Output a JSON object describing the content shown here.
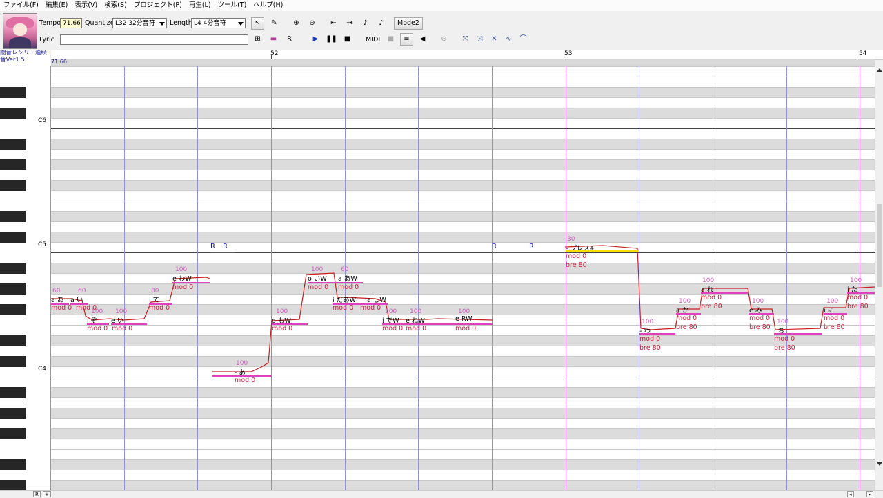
{
  "menu": [
    "ファイル(F)",
    "編集(E)",
    "表示(V)",
    "検索(S)",
    "プロジェクト(P)",
    "再生(L)",
    "ツール(T)",
    "ヘルプ(H)"
  ],
  "toolbar": {
    "tempo_label": "Tempo",
    "tempo_value": "71.66",
    "quantize_label": "Quantize",
    "quantize_value": "L32 32分音符",
    "length_label": "Length",
    "length_value": "L4 4分音符",
    "mode_label": "Mode2",
    "lyric_label": "Lyric",
    "lyric_value": "",
    "midi_label": "MIDI",
    "tool_r_label": "R"
  },
  "track": {
    "name_line1": "闇音レンリ・連続",
    "name_line2": "音Ver1.5",
    "tempo_marker": "71.66"
  },
  "ruler": {
    "measures": [
      {
        "label": "52"
      },
      {
        "label": "53"
      },
      {
        "label": "54"
      }
    ]
  },
  "keyboard": {
    "labels": [
      "C6",
      "C5",
      "C4"
    ]
  },
  "rests": [
    "R",
    "R",
    "R",
    "R"
  ],
  "notes": [
    {
      "lyric": "a あ",
      "vel": "60",
      "ctrl": "mod 0"
    },
    {
      "lyric": "a い",
      "vel": "60",
      "ctrl": "mod 0"
    },
    {
      "lyric": "i ぞ",
      "vel": "100",
      "ctrl": "mod 0"
    },
    {
      "lyric": "e い",
      "vel": "100",
      "ctrl": "mod 0"
    },
    {
      "lyric": "i て",
      "vel": "80",
      "ctrl": "mod 0"
    },
    {
      "lyric": "e わW",
      "vel": "100",
      "ctrl": "mod 0"
    },
    {
      "lyric": "- あ",
      "vel": "100",
      "ctrl": "mod 0"
    },
    {
      "lyric": "o もW",
      "vel": "100",
      "ctrl": "mod 0"
    },
    {
      "lyric": "o いW",
      "vel": "100",
      "ctrl": "mod 0"
    },
    {
      "lyric": "a あW",
      "vel": "60",
      "ctrl": "mod 0"
    },
    {
      "lyric": "i だあW",
      "vel": "",
      "ctrl": "mod 0"
    },
    {
      "lyric": "a しW",
      "vel": "",
      "ctrl": "mod 0"
    },
    {
      "lyric": "i でW",
      "vel": "100",
      "ctrl": "mod 0"
    },
    {
      "lyric": "e ねW",
      "vel": "100",
      "ctrl": "mod 0"
    },
    {
      "lyric": "e RW",
      "vel": "100",
      "ctrl": "mod 0"
    },
    {
      "lyric": "- ブレス4",
      "vel": "30",
      "ctrl": "mod 0",
      "ctrl2": "bre 80"
    },
    {
      "lyric": "- わ",
      "vel": "100",
      "ctrl": "mod 0",
      "ctrl2": "bre 80"
    },
    {
      "lyric": "a か",
      "vel": "100",
      "ctrl": "mod 0",
      "ctrl2": "bre 80"
    },
    {
      "lyric": "a れ",
      "vel": "100",
      "ctrl": "mod 0",
      "ctrl2": "bre 80"
    },
    {
      "lyric": "e み",
      "vel": "100",
      "ctrl": "mod 0",
      "ctrl2": "bre 80"
    },
    {
      "lyric": "i ち",
      "vel": "100",
      "ctrl": "mod 0",
      "ctrl2": "bre 80"
    },
    {
      "lyric": "i に",
      "vel": "100",
      "ctrl": "mod 0",
      "ctrl2": "bre 80"
    },
    {
      "lyric": "i た",
      "vel": "100",
      "ctrl": "mod 0",
      "ctrl2": "bre 80"
    }
  ],
  "colors": {
    "measure_line": "#e060e0",
    "beat_line": "#9090e0",
    "note_bar": "#e040c0",
    "pitch_curve": "#c82020",
    "row_shade": "#dcdcdc",
    "rest": "#1a1a9a",
    "ctrl": "#c8203a"
  },
  "icons": [
    "arrow-tool-icon",
    "pencil-tool-icon",
    "zoom-in-icon",
    "zoom-out-icon",
    "go-start-icon",
    "go-end-icon",
    "note-prev-icon",
    "note-next-icon",
    "play-icon",
    "pause-icon",
    "stop-icon",
    "record-icon",
    "metronome-icon",
    "speaker-icon",
    "phoneme-icon",
    "curve-tool-icons"
  ]
}
